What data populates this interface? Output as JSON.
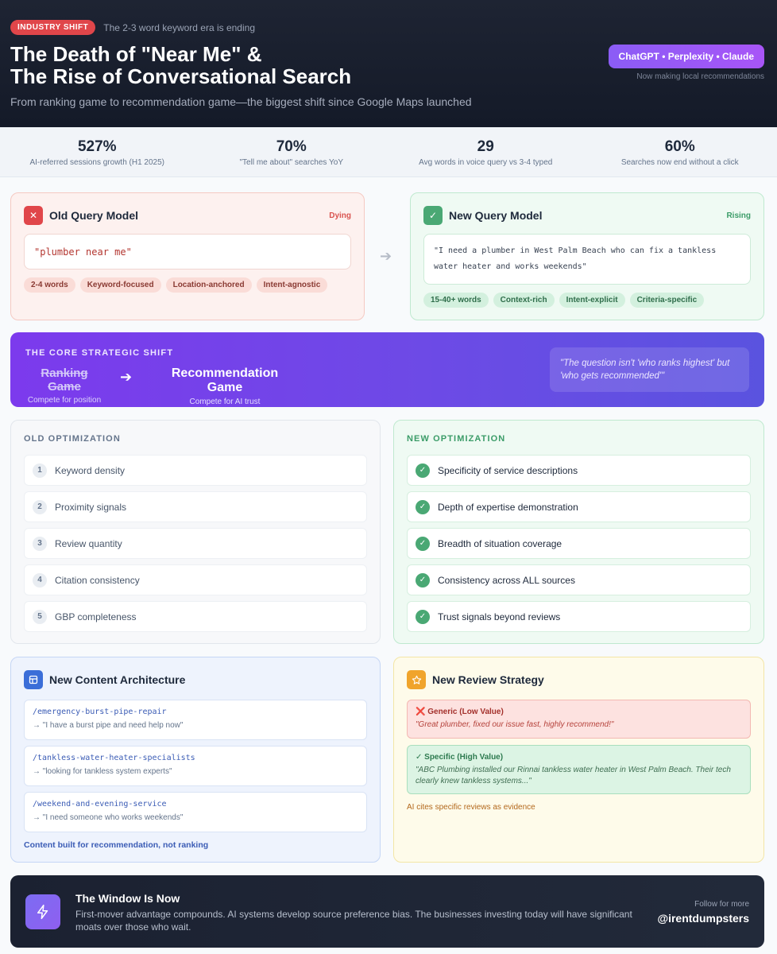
{
  "header": {
    "badge": "INDUSTRY SHIFT",
    "badge_subtitle": "The 2-3 word keyword era is ending",
    "title_line1": "The Death of \"Near Me\" &",
    "title_line2": "The Rise of Conversational Search",
    "subtitle": "From ranking game to recommendation game—the biggest shift since Google Maps launched",
    "ai_pill": "ChatGPT • Perplexity • Claude",
    "ai_note": "Now making local recommendations"
  },
  "stats": [
    {
      "value": "527%",
      "label": "AI-referred sessions growth (H1 2025)"
    },
    {
      "value": "70%",
      "label": "\"Tell me about\" searches YoY"
    },
    {
      "value": "29",
      "label": "Avg words in voice query vs 3-4 typed"
    },
    {
      "value": "60%",
      "label": "Searches now end without a click"
    }
  ],
  "old_query": {
    "title": "Old Query Model",
    "status": "Dying",
    "example": "\"plumber near me\"",
    "tags": [
      "2-4 words",
      "Keyword-focused",
      "Location-anchored",
      "Intent-agnostic"
    ]
  },
  "new_query": {
    "title": "New Query Model",
    "status": "Rising",
    "example": "\"I need a plumber in West Palm Beach who can fix a tankless water heater and works weekends\"",
    "tags": [
      "15-40+ words",
      "Context-rich",
      "Intent-explicit",
      "Criteria-specific"
    ]
  },
  "shift": {
    "label": "THE CORE STRATEGIC SHIFT",
    "old_title": "Ranking Game",
    "old_sub": "Compete for position",
    "new_title": "Recommendation Game",
    "new_sub": "Compete for AI trust",
    "quote": "\"The question isn't 'who ranks highest' but 'who gets recommended'\""
  },
  "old_optimization": {
    "label": "OLD OPTIMIZATION",
    "items": [
      {
        "num": "1",
        "text": "Keyword density"
      },
      {
        "num": "2",
        "text": "Proximity signals"
      },
      {
        "num": "3",
        "text": "Review quantity"
      },
      {
        "num": "4",
        "text": "Citation consistency"
      },
      {
        "num": "5",
        "text": "GBP completeness"
      }
    ]
  },
  "new_optimization": {
    "label": "NEW OPTIMIZATION",
    "items": [
      "Specificity of service descriptions",
      "Depth of expertise demonstration",
      "Breadth of situation coverage",
      "Consistency across ALL sources",
      "Trust signals beyond reviews"
    ]
  },
  "architecture": {
    "title": "New Content Architecture",
    "items": [
      {
        "path": "/emergency-burst-pipe-repair",
        "desc": "→ \"I have a burst pipe and need help now\""
      },
      {
        "path": "/tankless-water-heater-specialists",
        "desc": "→ \"looking for tankless system experts\""
      },
      {
        "path": "/weekend-and-evening-service",
        "desc": "→ \"I need someone who works weekends\""
      }
    ],
    "footer": "Content built for recommendation, not ranking"
  },
  "review": {
    "title": "New Review Strategy",
    "bad_label": "❌ Generic (Low Value)",
    "bad_text": "\"Great plumber, fixed our issue fast, highly recommend!\"",
    "good_label": "✓ Specific (High Value)",
    "good_text": "\"ABC Plumbing installed our Rinnai tankless water heater in West Palm Beach. Their tech clearly knew tankless systems...\"",
    "footer": "AI cites specific reviews as evidence"
  },
  "footer": {
    "title": "The Window Is Now",
    "text": "First-mover advantage compounds. AI systems develop source preference bias. The businesses investing today will have significant moats over those who wait.",
    "follow": "Follow for more",
    "handle": "@irentdumpsters"
  },
  "colors": {
    "accent_red": "#e0464a",
    "accent_green": "#4aa874",
    "accent_purple": "#7c3aed",
    "accent_blue": "#3b6ed8",
    "accent_amber": "#f0a42c"
  },
  "icons": {
    "old_query": "close-icon",
    "new_query": "check-icon",
    "architecture": "layout-icon",
    "review": "star-icon",
    "footer": "lightning-icon"
  }
}
